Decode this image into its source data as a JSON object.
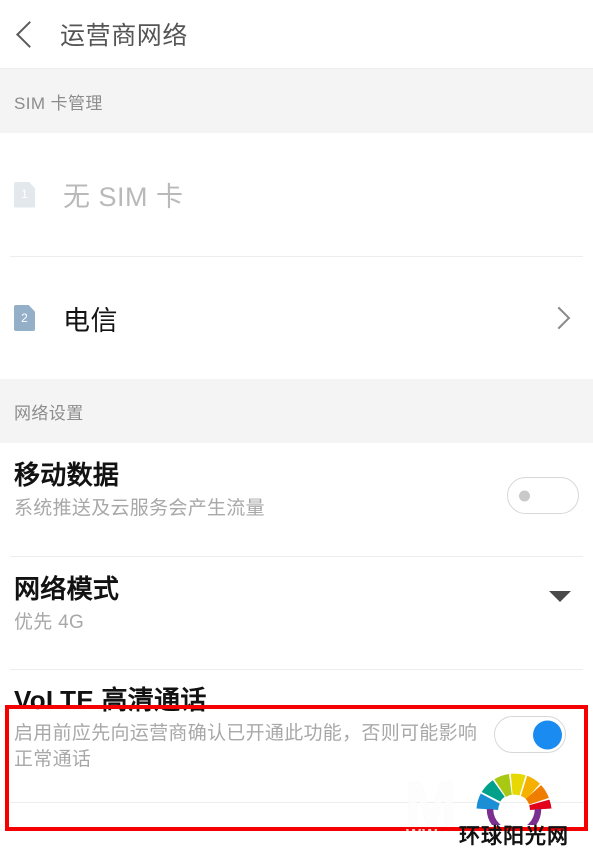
{
  "appbar": {
    "back_icon": "chevron-left-icon",
    "title": "运营商网络"
  },
  "sections": [
    {
      "label": "SIM 卡管理",
      "rows": [
        {
          "badge": "1",
          "badge_state": "inactive",
          "title": "无 SIM 卡",
          "accessory": "none"
        },
        {
          "badge": "2",
          "badge_state": "active",
          "title": "电信",
          "accessory": "chevron-right-icon"
        }
      ]
    },
    {
      "label": "网络设置",
      "settings": [
        {
          "title": "移动数据",
          "subtitle": "系统推送及云服务会产生流量",
          "control": "toggle",
          "state": "off"
        },
        {
          "title": "网络模式",
          "subtitle": "优先 4G",
          "control": "dropdown",
          "state": "优先 4G"
        },
        {
          "title": "VoLTE 高清通话",
          "subtitle": "启用前应先向运营商确认已开通此功能，否则可能影响正常通话",
          "control": "toggle",
          "state": "on"
        }
      ]
    }
  ],
  "highlight": {
    "color": "#f40000",
    "target": "VoLTE 高清通话"
  },
  "watermark": {
    "big": "M",
    "small": "WW"
  },
  "logo": {
    "text": "环球阳光网",
    "colors": [
      "#1a8fd6",
      "#00a08a",
      "#a8c814",
      "#e6d800",
      "#f5b000",
      "#ef7d00",
      "#e2001a",
      "#7b2f8f"
    ]
  },
  "theme": {
    "accent": "#1a8bf0",
    "band_bg": "#f4f4f4",
    "divider": "#ededed",
    "sim_active": "#93b0c8",
    "sim_inactive": "#e2e8ec"
  }
}
